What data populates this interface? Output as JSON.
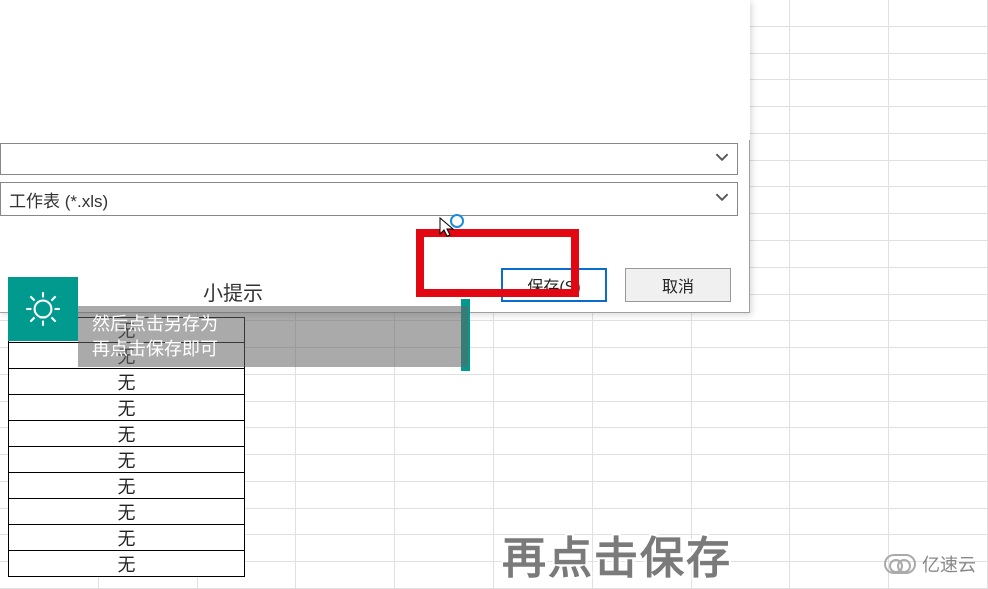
{
  "dialog": {
    "filename_value": "",
    "filetype_value": "工作表 (*.xls)",
    "save_label": "保存(S)",
    "cancel_label": "取消"
  },
  "tip": {
    "title": "小提示",
    "line1": "然后点击另存为",
    "line2": "再点击保存即可"
  },
  "table": {
    "rows": [
      "无",
      "无",
      "无",
      "无",
      "无",
      "无",
      "无",
      "无",
      "无",
      "无"
    ]
  },
  "caption": "再点击保存",
  "watermark_text": "亿速云"
}
